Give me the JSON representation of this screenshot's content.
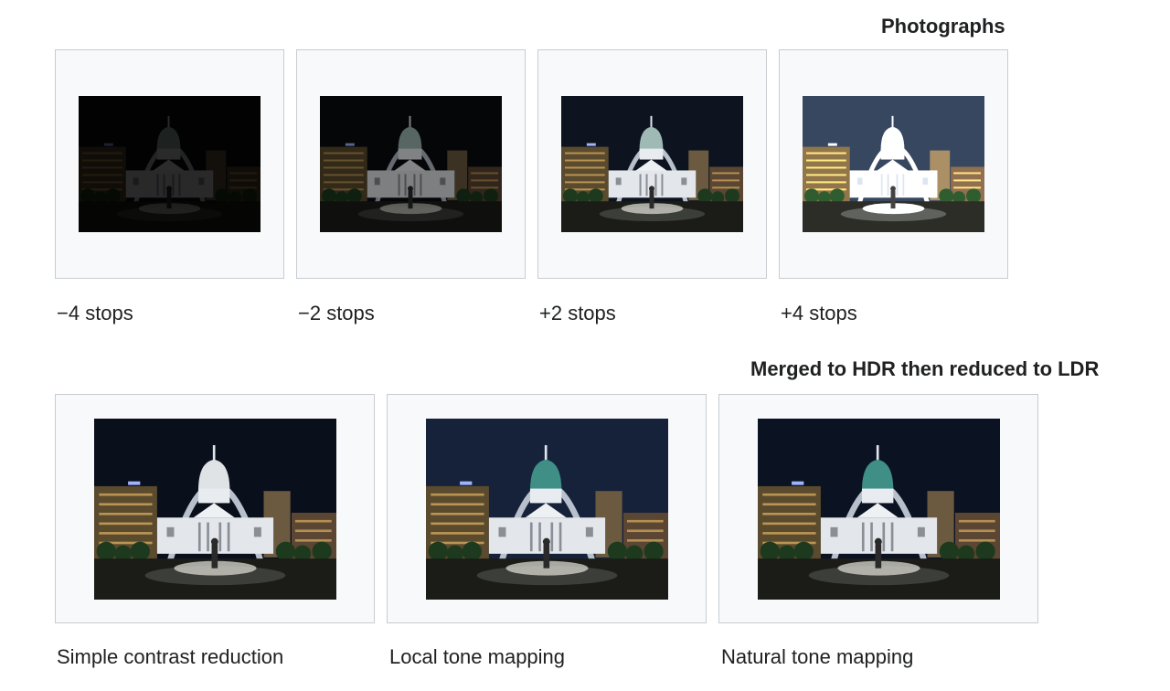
{
  "sections": {
    "photographs": "Photographs",
    "merged": "Merged to HDR then reduced to LDR"
  },
  "photographs": [
    {
      "caption": "−4 stops",
      "brightness": 0.18,
      "sky": "#020203"
    },
    {
      "caption": "−2 stops",
      "brightness": 0.55,
      "sky": "#050608"
    },
    {
      "caption": "+2 stops",
      "brightness": 1.0,
      "sky": "#0d1420"
    },
    {
      "caption": "+4 stops",
      "brightness": 1.6,
      "sky": "#36475f"
    }
  ],
  "merged": [
    {
      "caption": "Simple contrast reduction",
      "sky": "#0a0f1c"
    },
    {
      "caption": "Local tone mapping",
      "sky": "#16223a"
    },
    {
      "caption": "Natural tone mapping",
      "sky": "#0b1221"
    }
  ],
  "colors": {
    "frame_bg": "#f8f9fa",
    "frame_border": "#c8ccd1",
    "text": "#202122"
  }
}
